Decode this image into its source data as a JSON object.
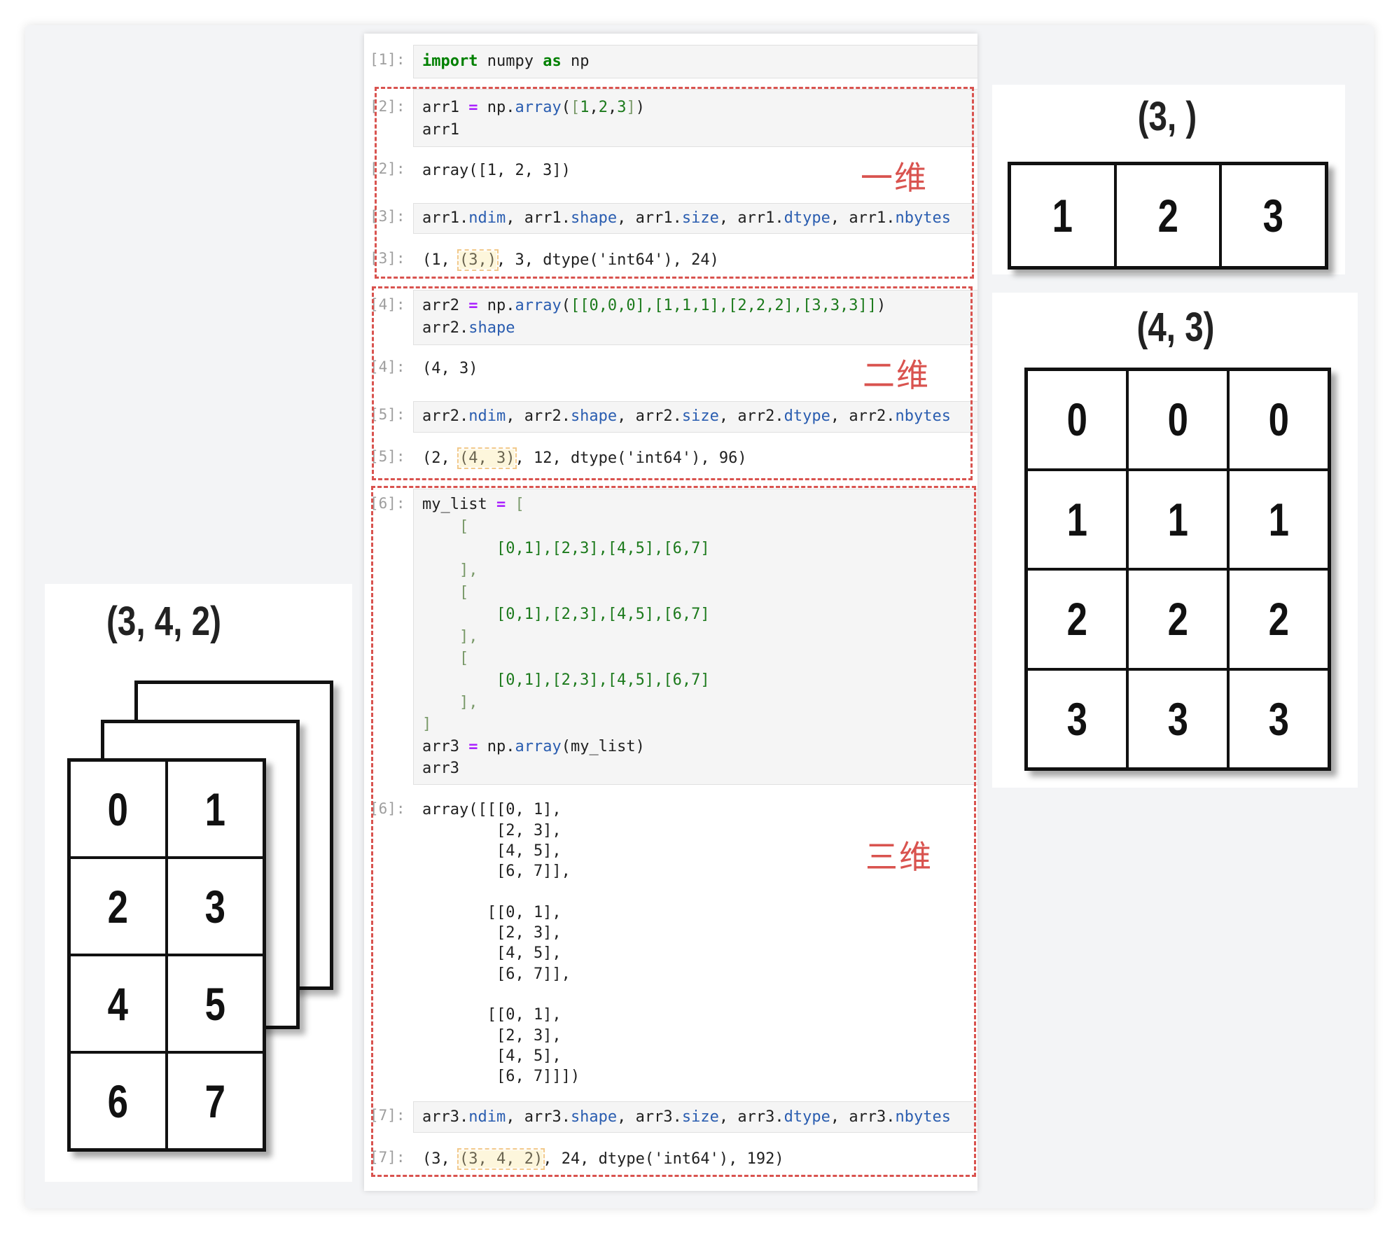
{
  "notebook": {
    "cells": [
      {
        "kind": "in",
        "prompt": "[1]:",
        "lines": [
          [
            [
              "import",
              "kw"
            ],
            [
              " numpy ",
              ""
            ],
            [
              "as",
              "kw"
            ],
            [
              " np",
              ""
            ]
          ]
        ]
      },
      {
        "kind": "in",
        "prompt": "[2]:",
        "lines": [
          [
            [
              "arr1 ",
              ""
            ],
            [
              "=",
              "op"
            ],
            [
              " np.",
              ""
            ],
            [
              "array",
              "fn"
            ],
            [
              "(",
              ""
            ],
            [
              "[",
              "br"
            ],
            [
              "1",
              "num"
            ],
            [
              ",",
              ""
            ],
            [
              "2",
              "num"
            ],
            [
              ",",
              ""
            ],
            [
              "3",
              "num"
            ],
            [
              "]",
              "br"
            ],
            [
              ")",
              ""
            ]
          ],
          [
            [
              "arr1",
              ""
            ]
          ]
        ]
      },
      {
        "kind": "out",
        "prompt": "[2]:",
        "lines": [
          [
            [
              "array([1, 2, 3])",
              ""
            ]
          ]
        ]
      },
      {
        "kind": "in",
        "prompt": "[3]:",
        "lines": [
          [
            [
              "arr1.",
              ""
            ],
            [
              "ndim",
              "fn"
            ],
            [
              ", arr1.",
              ""
            ],
            [
              "shape",
              "fn"
            ],
            [
              ", arr1.",
              ""
            ],
            [
              "size",
              "fn"
            ],
            [
              ", arr1.",
              ""
            ],
            [
              "dtype",
              "fn"
            ],
            [
              ", arr1.",
              ""
            ],
            [
              "nbytes",
              "fn"
            ]
          ]
        ]
      },
      {
        "kind": "out",
        "prompt": "[3]:",
        "lines": [
          [
            [
              "(1, ",
              ""
            ],
            [
              "(3,)",
              "hl"
            ],
            [
              ", 3, dtype('int64'), 24)",
              ""
            ]
          ]
        ]
      },
      {
        "kind": "in",
        "prompt": "[4]:",
        "lines": [
          [
            [
              "arr2 ",
              ""
            ],
            [
              "=",
              "op"
            ],
            [
              " np.",
              ""
            ],
            [
              "array",
              "fn"
            ],
            [
              "(",
              ""
            ],
            [
              "[[0,0,0],[1,1,1],[2,2,2],[3,3,3]]",
              "lit"
            ],
            [
              ")",
              ""
            ]
          ],
          [
            [
              "arr2.",
              ""
            ],
            [
              "shape",
              "fn"
            ]
          ]
        ]
      },
      {
        "kind": "out",
        "prompt": "[4]:",
        "lines": [
          [
            [
              "(4, 3)",
              ""
            ]
          ]
        ]
      },
      {
        "kind": "in",
        "prompt": "[5]:",
        "lines": [
          [
            [
              "arr2.",
              ""
            ],
            [
              "ndim",
              "fn"
            ],
            [
              ", arr2.",
              ""
            ],
            [
              "shape",
              "fn"
            ],
            [
              ", arr2.",
              ""
            ],
            [
              "size",
              "fn"
            ],
            [
              ", arr2.",
              ""
            ],
            [
              "dtype",
              "fn"
            ],
            [
              ", arr2.",
              ""
            ],
            [
              "nbytes",
              "fn"
            ]
          ]
        ]
      },
      {
        "kind": "out",
        "prompt": "[5]:",
        "lines": [
          [
            [
              "(2, ",
              ""
            ],
            [
              "(4, 3)",
              "hl"
            ],
            [
              ", 12, dtype('int64'), 96)",
              ""
            ]
          ]
        ]
      },
      {
        "kind": "in",
        "prompt": "[6]:",
        "lines": [
          [
            [
              "my_list ",
              ""
            ],
            [
              "=",
              "op"
            ],
            [
              " ",
              ""
            ],
            [
              "[",
              "br"
            ]
          ],
          [
            [
              "    ",
              ""
            ],
            [
              "[",
              "br"
            ]
          ],
          [
            [
              "        ",
              ""
            ],
            [
              "[0,1],[2,3],[4,5],[6,7]",
              "lit"
            ]
          ],
          [
            [
              "    ",
              ""
            ],
            [
              "],",
              "br"
            ]
          ],
          [
            [
              "    ",
              ""
            ],
            [
              "[",
              "br"
            ]
          ],
          [
            [
              "        ",
              ""
            ],
            [
              "[0,1],[2,3],[4,5],[6,7]",
              "lit"
            ]
          ],
          [
            [
              "    ",
              ""
            ],
            [
              "],",
              "br"
            ]
          ],
          [
            [
              "    ",
              ""
            ],
            [
              "[",
              "br"
            ]
          ],
          [
            [
              "        ",
              ""
            ],
            [
              "[0,1],[2,3],[4,5],[6,7]",
              "lit"
            ]
          ],
          [
            [
              "    ",
              ""
            ],
            [
              "],",
              "br"
            ]
          ],
          [
            [
              "]",
              "br"
            ]
          ],
          [
            [
              "arr3 ",
              ""
            ],
            [
              "=",
              "op"
            ],
            [
              " np.",
              ""
            ],
            [
              "array",
              "fn"
            ],
            [
              "(my_list)",
              ""
            ]
          ],
          [
            [
              "arr3",
              ""
            ]
          ]
        ]
      },
      {
        "kind": "out",
        "prompt": "[6]:",
        "lines": [
          [
            [
              "array([[[0, 1],",
              ""
            ]
          ],
          [
            [
              "        [2, 3],",
              ""
            ]
          ],
          [
            [
              "        [4, 5],",
              ""
            ]
          ],
          [
            [
              "        [6, 7]],",
              ""
            ]
          ],
          [
            [
              "",
              ""
            ]
          ],
          [
            [
              "       [[0, 1],",
              ""
            ]
          ],
          [
            [
              "        [2, 3],",
              ""
            ]
          ],
          [
            [
              "        [4, 5],",
              ""
            ]
          ],
          [
            [
              "        [6, 7]],",
              ""
            ]
          ],
          [
            [
              "",
              ""
            ]
          ],
          [
            [
              "       [[0, 1],",
              ""
            ]
          ],
          [
            [
              "        [2, 3],",
              ""
            ]
          ],
          [
            [
              "        [4, 5],",
              ""
            ]
          ],
          [
            [
              "        [6, 7]]])",
              ""
            ]
          ]
        ]
      },
      {
        "kind": "in",
        "prompt": "[7]:",
        "lines": [
          [
            [
              "arr3.",
              ""
            ],
            [
              "ndim",
              "fn"
            ],
            [
              ", arr3.",
              ""
            ],
            [
              "shape",
              "fn"
            ],
            [
              ", arr3.",
              ""
            ],
            [
              "size",
              "fn"
            ],
            [
              ", arr3.",
              ""
            ],
            [
              "dtype",
              "fn"
            ],
            [
              ", arr3.",
              ""
            ],
            [
              "nbytes",
              "fn"
            ]
          ]
        ]
      },
      {
        "kind": "out",
        "prompt": "[7]:",
        "lines": [
          [
            [
              "(3, ",
              ""
            ],
            [
              "(3, 4, 2)",
              "hl"
            ],
            [
              ", 24, dtype('int64'), 192)",
              ""
            ]
          ]
        ]
      }
    ]
  },
  "annotations": {
    "one_d": "一维",
    "two_d": "二维",
    "three_d": "三维",
    "color": "#d9534f"
  },
  "diagrams": {
    "shape_1d": {
      "title": "(3, )",
      "values": [
        "1",
        "2",
        "3"
      ]
    },
    "shape_2d": {
      "title": "(4, 3)",
      "values": [
        "0",
        "0",
        "0",
        "1",
        "1",
        "1",
        "2",
        "2",
        "2",
        "3",
        "3",
        "3"
      ]
    },
    "shape_3d": {
      "title": "(3, 4, 2)",
      "values": [
        "0",
        "1",
        "2",
        "3",
        "4",
        "5",
        "6",
        "7"
      ]
    }
  }
}
